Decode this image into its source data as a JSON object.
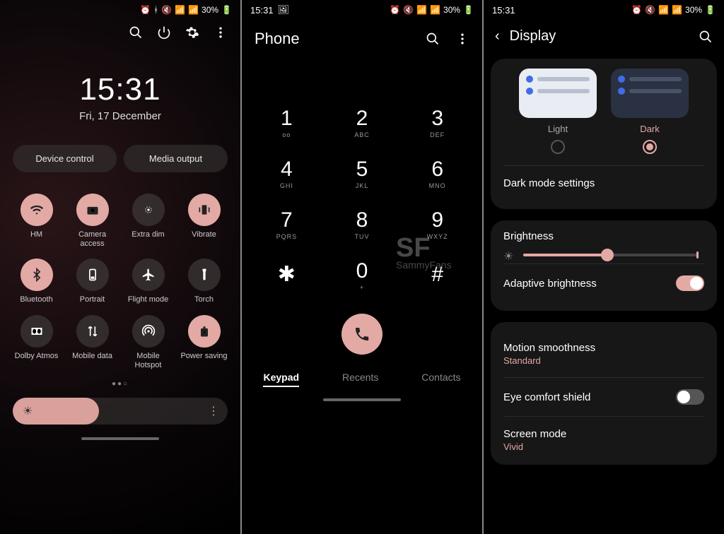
{
  "status": {
    "time": "15:31",
    "battery": "30%"
  },
  "panel1": {
    "clock": "15:31",
    "date": "Fri, 17 December",
    "pills": [
      "Device control",
      "Media output"
    ],
    "tiles": [
      {
        "label": "HM",
        "icon": "wifi",
        "on": true
      },
      {
        "label": "Camera access",
        "icon": "camera",
        "on": true
      },
      {
        "label": "Extra dim",
        "icon": "dim",
        "on": false
      },
      {
        "label": "Vibrate",
        "icon": "vibrate",
        "on": true
      },
      {
        "label": "Bluetooth",
        "icon": "bluetooth",
        "on": true
      },
      {
        "label": "Portrait",
        "icon": "portrait",
        "on": false
      },
      {
        "label": "Flight mode",
        "icon": "plane",
        "on": false
      },
      {
        "label": "Torch",
        "icon": "torch",
        "on": false
      },
      {
        "label": "Dolby Atmos",
        "icon": "dolby",
        "on": false
      },
      {
        "label": "Mobile data",
        "icon": "data",
        "on": false
      },
      {
        "label": "Mobile Hotspot",
        "icon": "hotspot",
        "on": false
      },
      {
        "label": "Power saving",
        "icon": "battery",
        "on": true
      }
    ]
  },
  "panel2": {
    "title": "Phone",
    "keys": [
      {
        "num": "1",
        "sub": "ᴏᴏ"
      },
      {
        "num": "2",
        "sub": "ABC"
      },
      {
        "num": "3",
        "sub": "DEF"
      },
      {
        "num": "4",
        "sub": "GHI"
      },
      {
        "num": "5",
        "sub": "JKL"
      },
      {
        "num": "6",
        "sub": "MNO"
      },
      {
        "num": "7",
        "sub": "PQRS"
      },
      {
        "num": "8",
        "sub": "TUV"
      },
      {
        "num": "9",
        "sub": "WXYZ"
      },
      {
        "num": "✱",
        "sub": ""
      },
      {
        "num": "0",
        "sub": "+"
      },
      {
        "num": "#",
        "sub": ""
      }
    ],
    "tabs": [
      "Keypad",
      "Recents",
      "Contacts"
    ],
    "active_tab": 0
  },
  "panel3": {
    "title": "Display",
    "themes": [
      {
        "label": "Light",
        "selected": false
      },
      {
        "label": "Dark",
        "selected": true
      }
    ],
    "dark_mode_settings": "Dark mode settings",
    "brightness_label": "Brightness",
    "brightness_value": 48,
    "adaptive": {
      "label": "Adaptive brightness",
      "on": true
    },
    "motion": {
      "label": "Motion smoothness",
      "value": "Standard"
    },
    "eye": {
      "label": "Eye comfort shield",
      "on": false
    },
    "screen_mode": {
      "label": "Screen mode",
      "value": "Vivid"
    }
  },
  "watermark": {
    "big": "SF",
    "small": "SammyFans"
  }
}
